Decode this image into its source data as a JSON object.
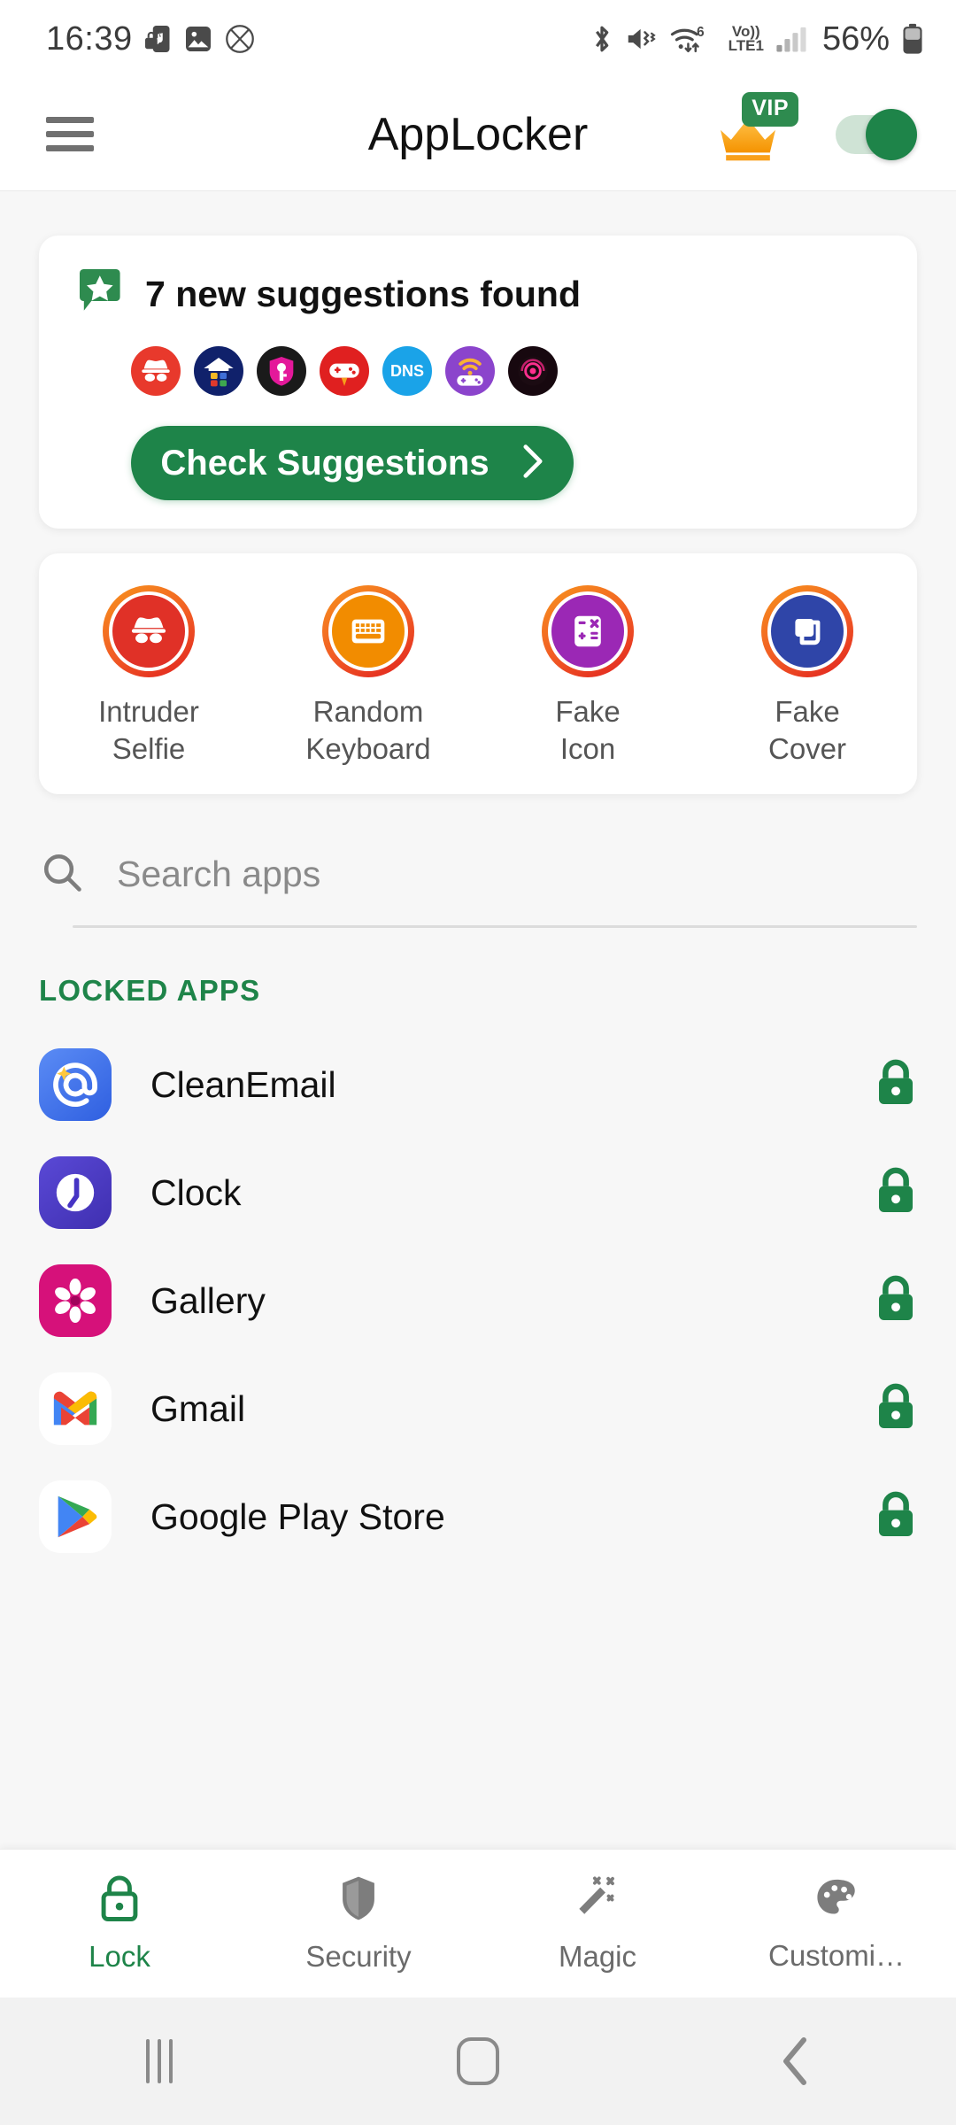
{
  "status_bar": {
    "time": "16:39",
    "left_icons": [
      "music-note-lock-icon",
      "image-icon",
      "no-sim-circle-icon"
    ],
    "right_icons": [
      "bluetooth-icon",
      "mute-vibrate-icon",
      "wifi6-data-icon",
      "signal-bars-icon"
    ],
    "wifi_generation": "6",
    "network_line1": "Vo))",
    "network_line2": "LTE1",
    "battery_percent": "56%"
  },
  "header": {
    "menu_icon": "hamburger-menu-icon",
    "title": "AppLocker",
    "vip_badge": "VIP",
    "crown_icon": "crown-icon",
    "toggle_state": "on"
  },
  "suggestions": {
    "badge_icon": "star-speech-bubble-icon",
    "title": "7 new suggestions found",
    "count": 7,
    "button_label": "Check Suggestions",
    "button_color": "#1e8449",
    "chevron_icon": "chevron-right-icon",
    "app_icons": [
      {
        "name": "incognito-app-icon",
        "bg": "#e8392c",
        "glyph": "spy"
      },
      {
        "name": "launcher-app-icon",
        "bg": "#10216b",
        "glyph": "house"
      },
      {
        "name": "key-vault-app-icon",
        "bg": "#1a1a1a",
        "glyph": "key"
      },
      {
        "name": "game-booster-app-icon",
        "bg": "#e02020",
        "glyph": "gamepad"
      },
      {
        "name": "dns-changer-app-icon",
        "bg": "#1aa3e8",
        "glyph": "DNS"
      },
      {
        "name": "game-wifi-app-icon",
        "bg": "#8b44cc",
        "glyph": "gamepad-wifi"
      },
      {
        "name": "radar-app-icon",
        "bg": "#17080f",
        "glyph": "radar"
      }
    ]
  },
  "features": [
    {
      "icon": "intruder-selfie-icon",
      "fill": "#e03127",
      "label_line1": "Intruder",
      "label_line2": "Selfie"
    },
    {
      "icon": "random-keyboard-icon",
      "fill": "#f28c00",
      "label_line1": "Random",
      "label_line2": "Keyboard"
    },
    {
      "icon": "fake-icon-calculator-icon",
      "fill": "#9b28b5",
      "label_line1": "Fake",
      "label_line2": "Icon"
    },
    {
      "icon": "fake-cover-icon",
      "fill": "#2f45a8",
      "label_line1": "Fake",
      "label_line2": "Cover"
    }
  ],
  "search": {
    "icon": "search-icon",
    "placeholder": "Search apps",
    "value": ""
  },
  "locked_section": {
    "title": "LOCKED APPS",
    "accent": "#1e8449"
  },
  "apps": [
    {
      "name": "CleanEmail",
      "icon": "cleanemail-app-icon",
      "locked": true
    },
    {
      "name": "Clock",
      "icon": "clock-app-icon",
      "locked": true
    },
    {
      "name": "Gallery",
      "icon": "gallery-app-icon",
      "locked": true
    },
    {
      "name": "Gmail",
      "icon": "gmail-app-icon",
      "locked": true
    },
    {
      "name": "Google Play Store",
      "icon": "play-store-app-icon",
      "locked": true
    }
  ],
  "bottom_nav": [
    {
      "label": "Lock",
      "icon": "lock-icon",
      "active": true
    },
    {
      "label": "Security",
      "icon": "shield-icon",
      "active": false
    },
    {
      "label": "Magic",
      "icon": "magic-wand-icon",
      "active": false
    },
    {
      "label": "Customi…",
      "icon": "palette-icon",
      "active": false
    }
  ],
  "system_nav": {
    "recents": "recents-icon",
    "home": "home-icon",
    "back": "back-icon"
  }
}
